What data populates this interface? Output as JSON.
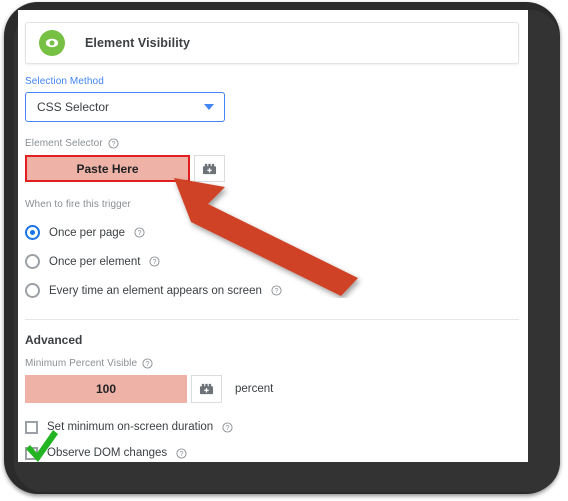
{
  "header": {
    "title": "Element Visibility",
    "icon": "eye-icon",
    "icon_bg": "#76c043"
  },
  "form": {
    "selection_method": {
      "label": "Selection Method",
      "value": "CSS Selector",
      "chevron_icon": "chevron-down-icon",
      "accent": "#4285f4"
    },
    "element_selector": {
      "label": "Element Selector",
      "help_icon": "help-icon",
      "value": "Paste Here",
      "placeholder": "Paste Here",
      "variable_icon": "variable-picker-icon",
      "highlight_fill": "#eeb3a6",
      "highlight_border": "#e02020"
    },
    "trigger_fire": {
      "label": "When to fire this trigger",
      "options": [
        {
          "label": "Once per page",
          "selected": true,
          "help_icon": "help-icon"
        },
        {
          "label": "Once per element",
          "selected": false,
          "help_icon": "help-icon"
        },
        {
          "label": "Every time an element appears on screen",
          "selected": false,
          "help_icon": "help-icon"
        }
      ]
    }
  },
  "advanced": {
    "title": "Advanced",
    "minimum_percent_visible": {
      "label": "Minimum Percent Visible",
      "help_icon": "help-icon",
      "value": "100",
      "suffix": "percent",
      "variable_icon": "variable-picker-icon",
      "highlight_fill": "#eeb3a6"
    },
    "checkboxes": [
      {
        "label": "Set minimum on-screen duration",
        "checked": false,
        "help_icon": "help-icon"
      },
      {
        "label": "Observe DOM changes",
        "checked": true,
        "help_icon": "help-icon"
      }
    ]
  },
  "annotations": {
    "arrow": {
      "name": "red-arrow-annotation",
      "color": "#cf4327",
      "points_to": "Paste Here"
    },
    "checkmark": {
      "name": "green-checkmark-annotation",
      "color": "#22b422",
      "marks": "Observe DOM changes"
    }
  }
}
